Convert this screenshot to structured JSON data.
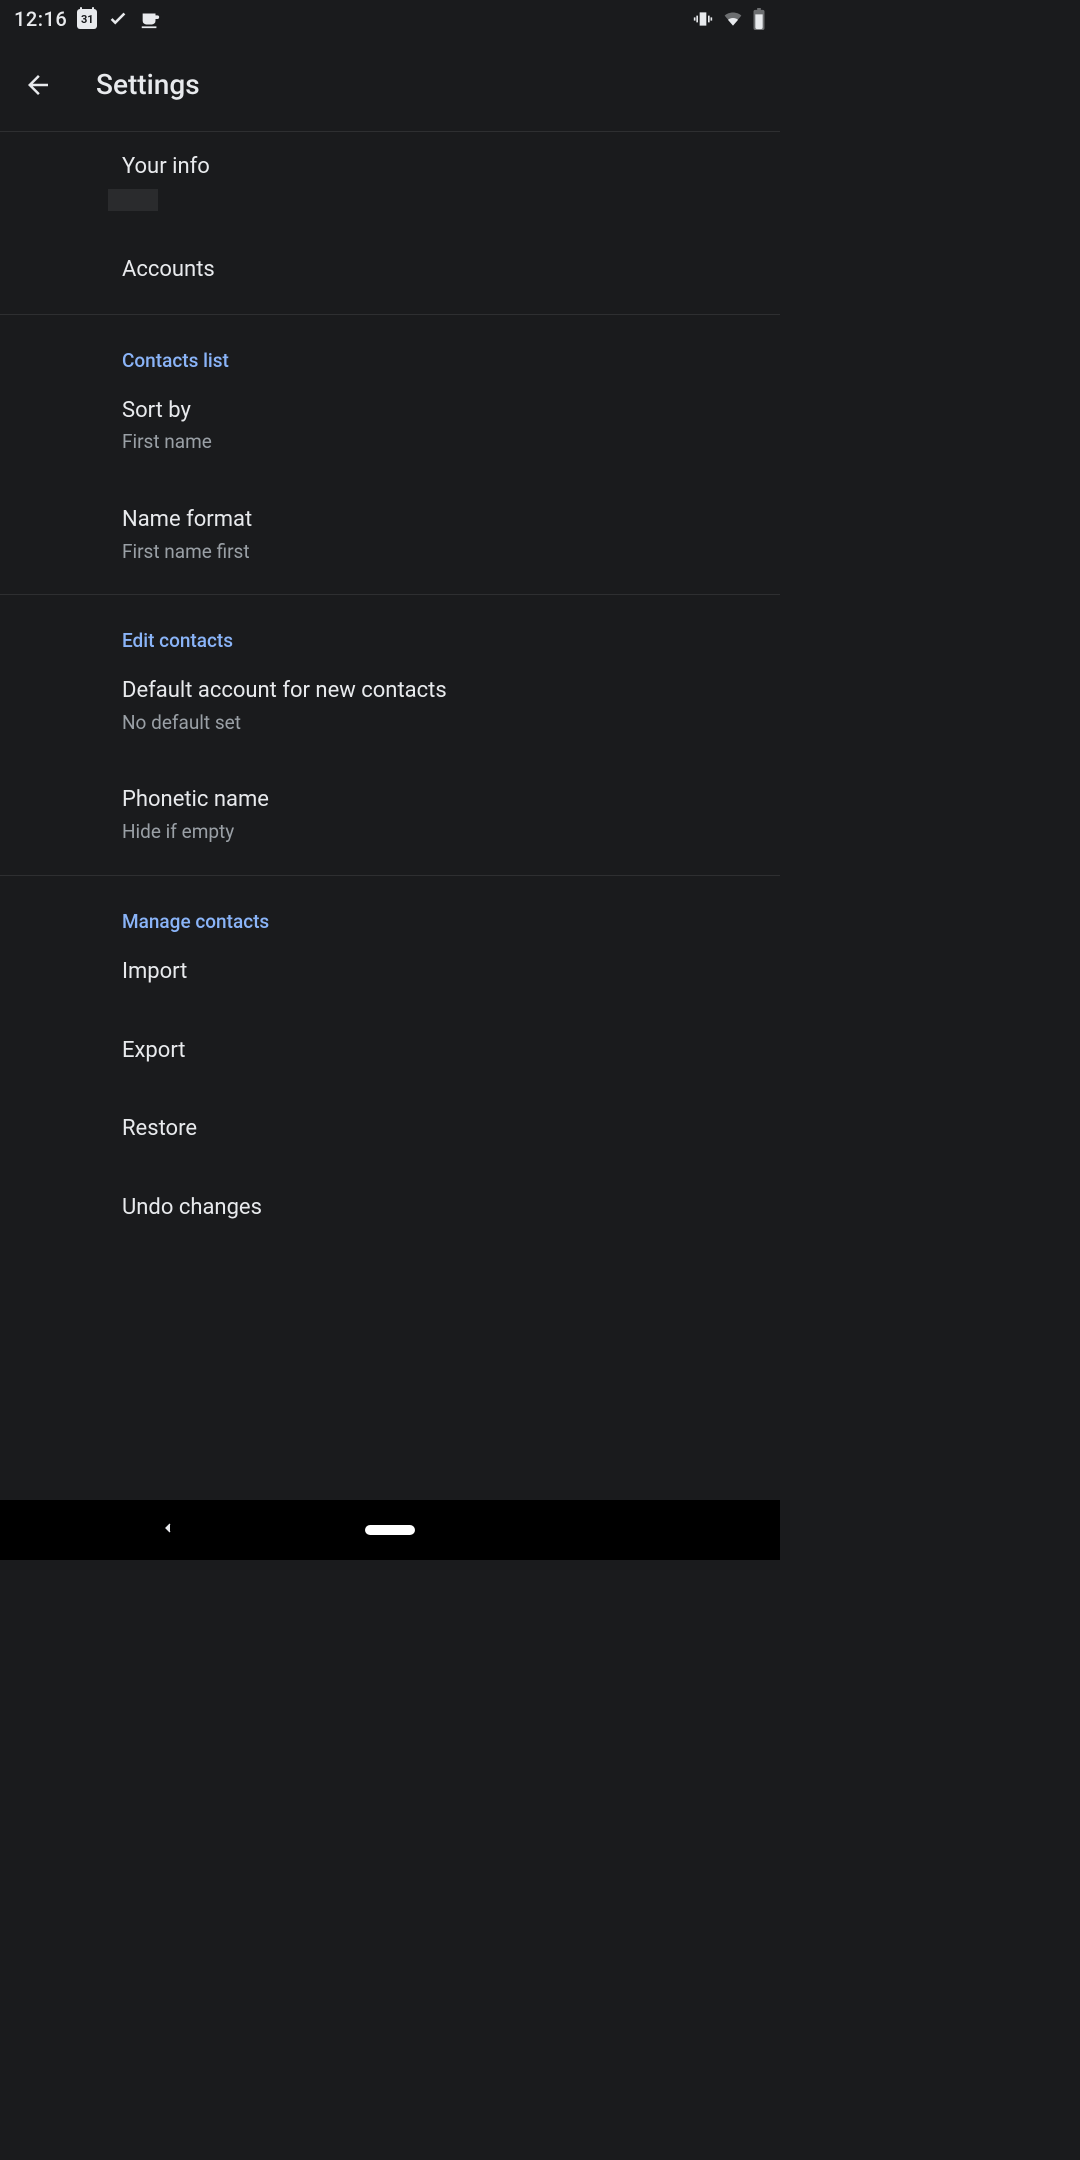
{
  "status": {
    "time": "12:16",
    "cal_day": "31"
  },
  "appbar": {
    "title": "Settings"
  },
  "sections": {
    "top": {
      "your_info": "Your info",
      "accounts": "Accounts"
    },
    "contacts_list": {
      "header": "Contacts list",
      "sort_by": {
        "title": "Sort by",
        "value": "First name"
      },
      "name_format": {
        "title": "Name format",
        "value": "First name first"
      }
    },
    "edit_contacts": {
      "header": "Edit contacts",
      "default_account": {
        "title": "Default account for new contacts",
        "value": "No default set"
      },
      "phonetic_name": {
        "title": "Phonetic name",
        "value": "Hide if empty"
      }
    },
    "manage_contacts": {
      "header": "Manage contacts",
      "import": "Import",
      "export": "Export",
      "restore": "Restore",
      "undo": "Undo changes"
    }
  }
}
